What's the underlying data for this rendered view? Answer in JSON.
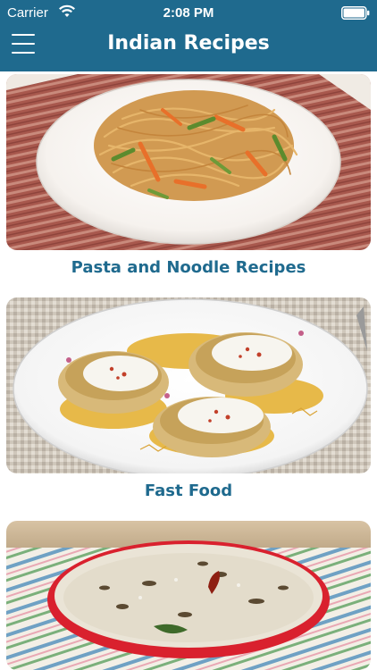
{
  "status_bar": {
    "carrier": "Carrier",
    "time": "2:08 PM",
    "wifi_icon": "wifi-icon",
    "battery_icon": "battery-icon"
  },
  "header": {
    "menu_icon": "hamburger-menu-icon",
    "title": "Indian Recipes"
  },
  "categories": [
    {
      "label": "Pasta and Noodle Recipes",
      "image": "noodles-plate-photo"
    },
    {
      "label": "Fast Food",
      "image": "dahi-puri-chaat-photo"
    },
    {
      "label": "",
      "image": "raita-bowl-photo"
    }
  ],
  "colors": {
    "brand": "#1f6a8e",
    "label_text": "#1f6a8e",
    "background": "#ffffff"
  }
}
